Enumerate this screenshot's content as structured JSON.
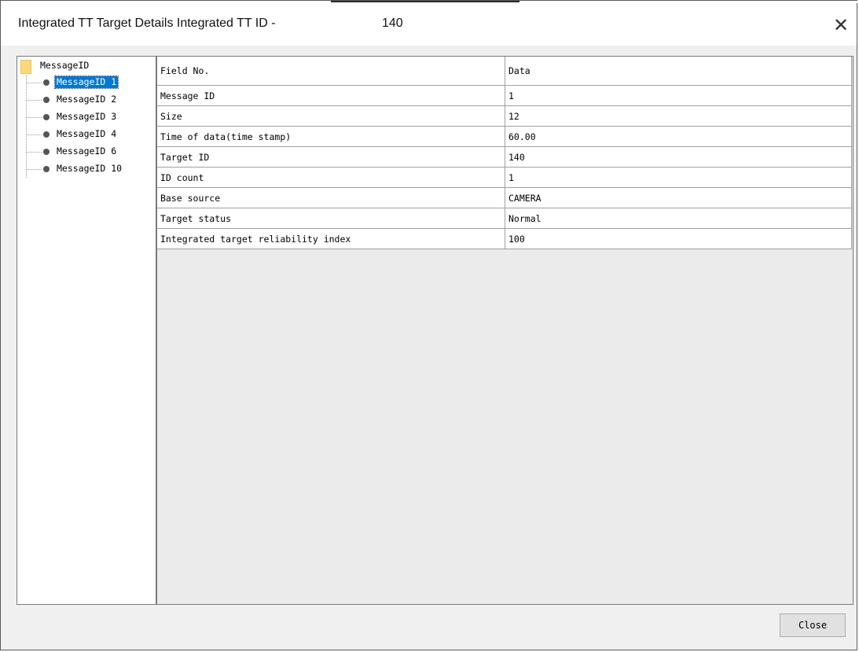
{
  "window": {
    "title": "Integrated TT Target Details Integrated TT ID -",
    "target_id": "140",
    "close_glyph": "✕"
  },
  "tree": {
    "root_label": "MessageID",
    "items": [
      {
        "label": "MessageID 1",
        "selected": true
      },
      {
        "label": "MessageID 2"
      },
      {
        "label": "MessageID 3"
      },
      {
        "label": "MessageID 4"
      },
      {
        "label": "MessageID 6"
      },
      {
        "label": "MessageID 10"
      }
    ]
  },
  "grid": {
    "headers": [
      "Field No.",
      "Data"
    ],
    "rows": [
      [
        "Message ID",
        "1"
      ],
      [
        "Size",
        "12"
      ],
      [
        "Time of data(time stamp)",
        "60.00"
      ],
      [
        "Target ID",
        "140"
      ],
      [
        "ID count",
        "1"
      ],
      [
        "Base source",
        "CAMERA"
      ],
      [
        "Target status",
        "Normal"
      ],
      [
        "Integrated target reliability index",
        "100"
      ]
    ]
  },
  "footer": {
    "close_label": "Close"
  }
}
